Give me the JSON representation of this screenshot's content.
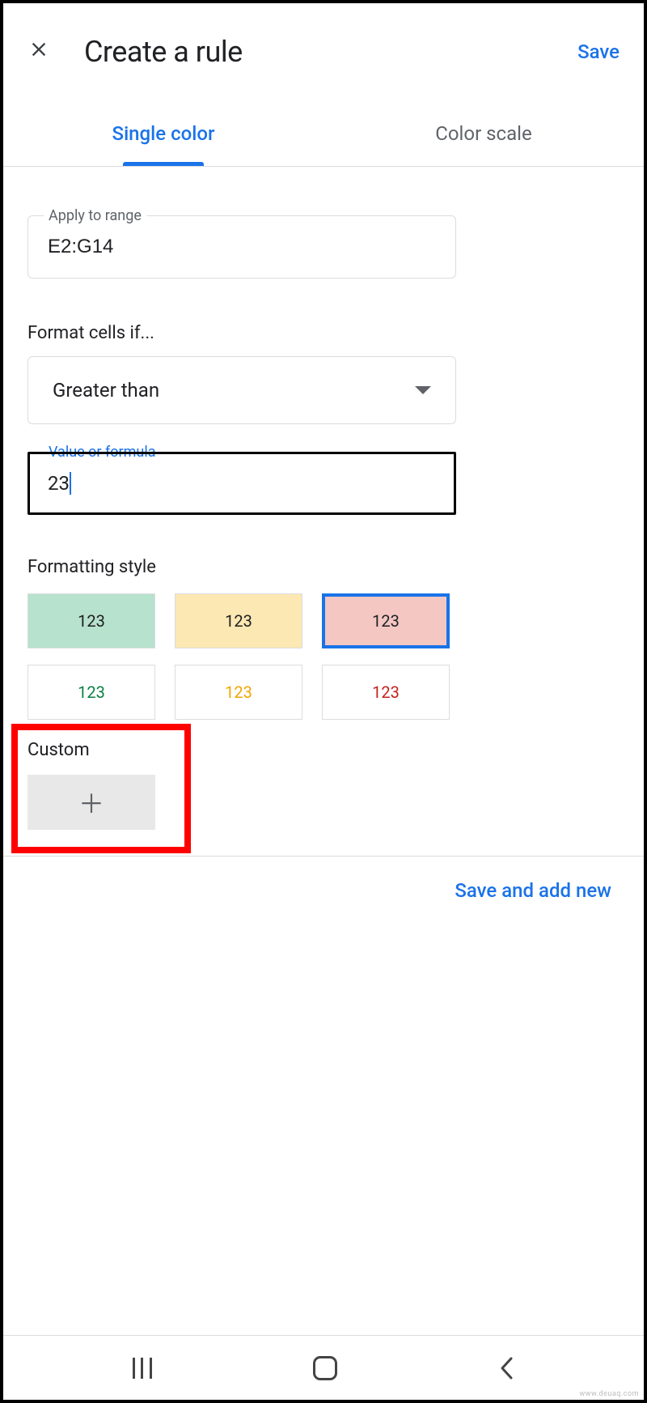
{
  "header": {
    "title": "Create a rule",
    "save_label": "Save"
  },
  "tabs": {
    "single_color": "Single color",
    "color_scale": "Color scale"
  },
  "range": {
    "label": "Apply to range",
    "value": "E2:G14"
  },
  "condition": {
    "label": "Format cells if...",
    "selected": "Greater than"
  },
  "value_field": {
    "label": "Value or formula",
    "value": "23"
  },
  "formatting": {
    "label": "Formatting style",
    "swatch_text": "123",
    "swatches": [
      {
        "bg": "#b7e2cd",
        "fg": "#202124",
        "selected": false
      },
      {
        "bg": "#fce8b2",
        "fg": "#202124",
        "selected": false
      },
      {
        "bg": "#f4c7c3",
        "fg": "#202124",
        "selected": true
      },
      {
        "bg": "#ffffff",
        "fg": "#0b8043",
        "selected": false
      },
      {
        "bg": "#ffffff",
        "fg": "#f2a600",
        "selected": false
      },
      {
        "bg": "#ffffff",
        "fg": "#c5221f",
        "selected": false
      }
    ],
    "custom_label": "Custom"
  },
  "footer": {
    "save_add_new": "Save and add new"
  },
  "watermark": "www.deuaq.com"
}
